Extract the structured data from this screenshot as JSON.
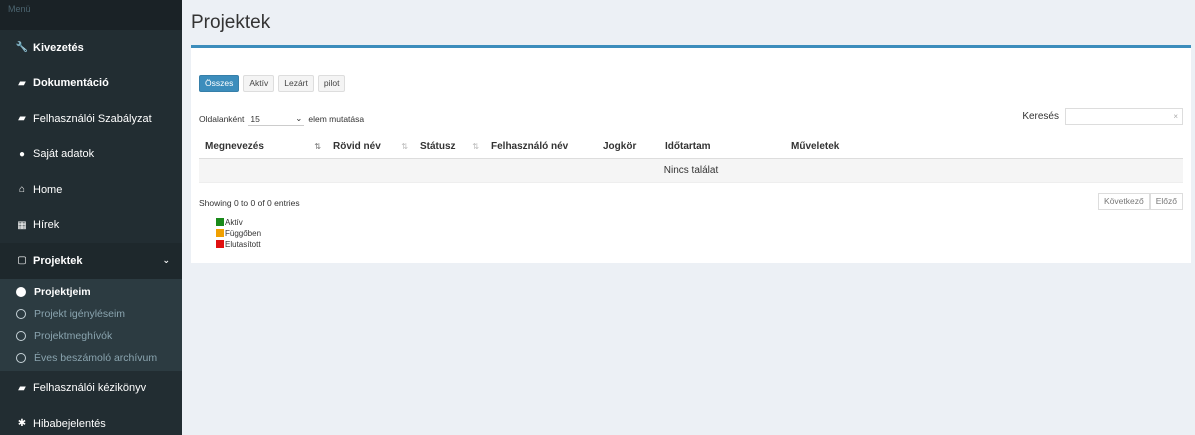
{
  "sidebar": {
    "header": "Menü",
    "items": [
      {
        "label": "Kivezetés",
        "icon": "wrench-icon"
      },
      {
        "label": "Dokumentáció",
        "icon": "book-icon"
      },
      {
        "label": "Felhasználói Szabályzat",
        "icon": "book-icon"
      },
      {
        "label": "Saját adatok",
        "icon": "user-icon"
      },
      {
        "label": "Home",
        "icon": "home-icon"
      },
      {
        "label": "Hírek",
        "icon": "newspaper-icon"
      },
      {
        "label": "Projektek",
        "icon": "file-icon"
      }
    ],
    "submenu": [
      {
        "label": "Projektjeim"
      },
      {
        "label": "Projekt igényléseim"
      },
      {
        "label": "Projektmeghívók"
      },
      {
        "label": "Éves beszámoló archívum"
      }
    ],
    "bottom_items": [
      {
        "label": "Felhasználói kézikönyv",
        "icon": "book-icon"
      },
      {
        "label": "Hibabejelentés",
        "icon": "bug-icon"
      }
    ]
  },
  "page": {
    "title": "Projektek"
  },
  "filters": [
    "Összes",
    "Aktív",
    "Lezárt",
    "pilot"
  ],
  "length": {
    "prefix": "Oldalanként",
    "value": "15",
    "suffix": "elem mutatása"
  },
  "search": {
    "label": "Keresés",
    "clear": "×"
  },
  "table": {
    "columns": [
      "Megnevezés",
      "Rövid név",
      "Státusz",
      "Felhasználó név",
      "Jogkör",
      "Időtartam",
      "Műveletek"
    ],
    "empty": "Nincs találat"
  },
  "info": "Showing 0 to 0 of 0 entries",
  "legend": [
    {
      "label": "Aktív",
      "color": "#1a8a1a"
    },
    {
      "label": "Függőben",
      "color": "#f0a000"
    },
    {
      "label": "Elutasított",
      "color": "#e01010"
    }
  ],
  "pager": {
    "next": "Következő",
    "prev": "Előző"
  },
  "colors": {
    "accent": "#3c8dbc",
    "sidebar": "#222d32"
  }
}
